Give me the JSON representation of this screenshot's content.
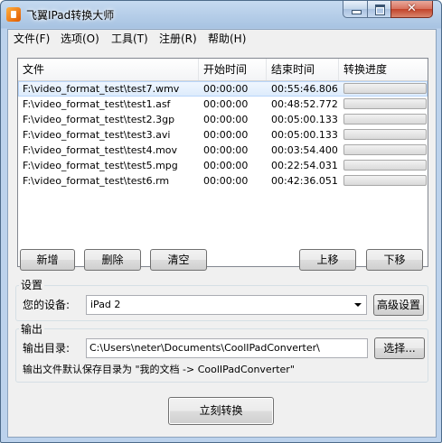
{
  "window": {
    "title": "飞翼IPad转换大师",
    "minimize_glyph": "",
    "close_glyph": "✕"
  },
  "menu": [
    {
      "label": "文件(F)"
    },
    {
      "label": "选项(O)"
    },
    {
      "label": "工具(T)"
    },
    {
      "label": "注册(R)"
    },
    {
      "label": "帮助(H)"
    }
  ],
  "table": {
    "columns": [
      "文件",
      "开始时间",
      "结束时间",
      "转换进度"
    ],
    "rows": [
      {
        "file": "F:\\video_format_test\\test7.wmv",
        "start": "00:00:00",
        "end": "00:55:46.806",
        "progress": 0
      },
      {
        "file": "F:\\video_format_test\\test1.asf",
        "start": "00:00:00",
        "end": "00:48:52.772",
        "progress": 0
      },
      {
        "file": "F:\\video_format_test\\test2.3gp",
        "start": "00:00:00",
        "end": "00:05:00.133",
        "progress": 0
      },
      {
        "file": "F:\\video_format_test\\test3.avi",
        "start": "00:00:00",
        "end": "00:05:00.133",
        "progress": 0
      },
      {
        "file": "F:\\video_format_test\\test4.mov",
        "start": "00:00:00",
        "end": "00:03:54.400",
        "progress": 0
      },
      {
        "file": "F:\\video_format_test\\test5.mpg",
        "start": "00:00:00",
        "end": "00:22:54.031",
        "progress": 0
      },
      {
        "file": "F:\\video_format_test\\test6.rm",
        "start": "00:00:00",
        "end": "00:42:36.051",
        "progress": 0
      }
    ]
  },
  "list_buttons": {
    "add": "新增",
    "delete": "删除",
    "clear": "清空",
    "move_up": "上移",
    "move_down": "下移"
  },
  "settings": {
    "group_label": "设置",
    "device_label": "您的设备:",
    "device_value": "iPad 2",
    "advanced_button": "高级设置"
  },
  "output": {
    "group_label": "输出",
    "dir_label": "输出目录:",
    "dir_value": "C:\\Users\\neter\\Documents\\CoolIPadConverter\\",
    "browse_button": "选择...",
    "note": "输出文件默认保存目录为 \"我的文档 -> CoolIPadConverter\""
  },
  "convert_button": "立刻转换",
  "colors": {
    "progress_fill": "#06b025",
    "title_bar": "#a8c3e2"
  }
}
